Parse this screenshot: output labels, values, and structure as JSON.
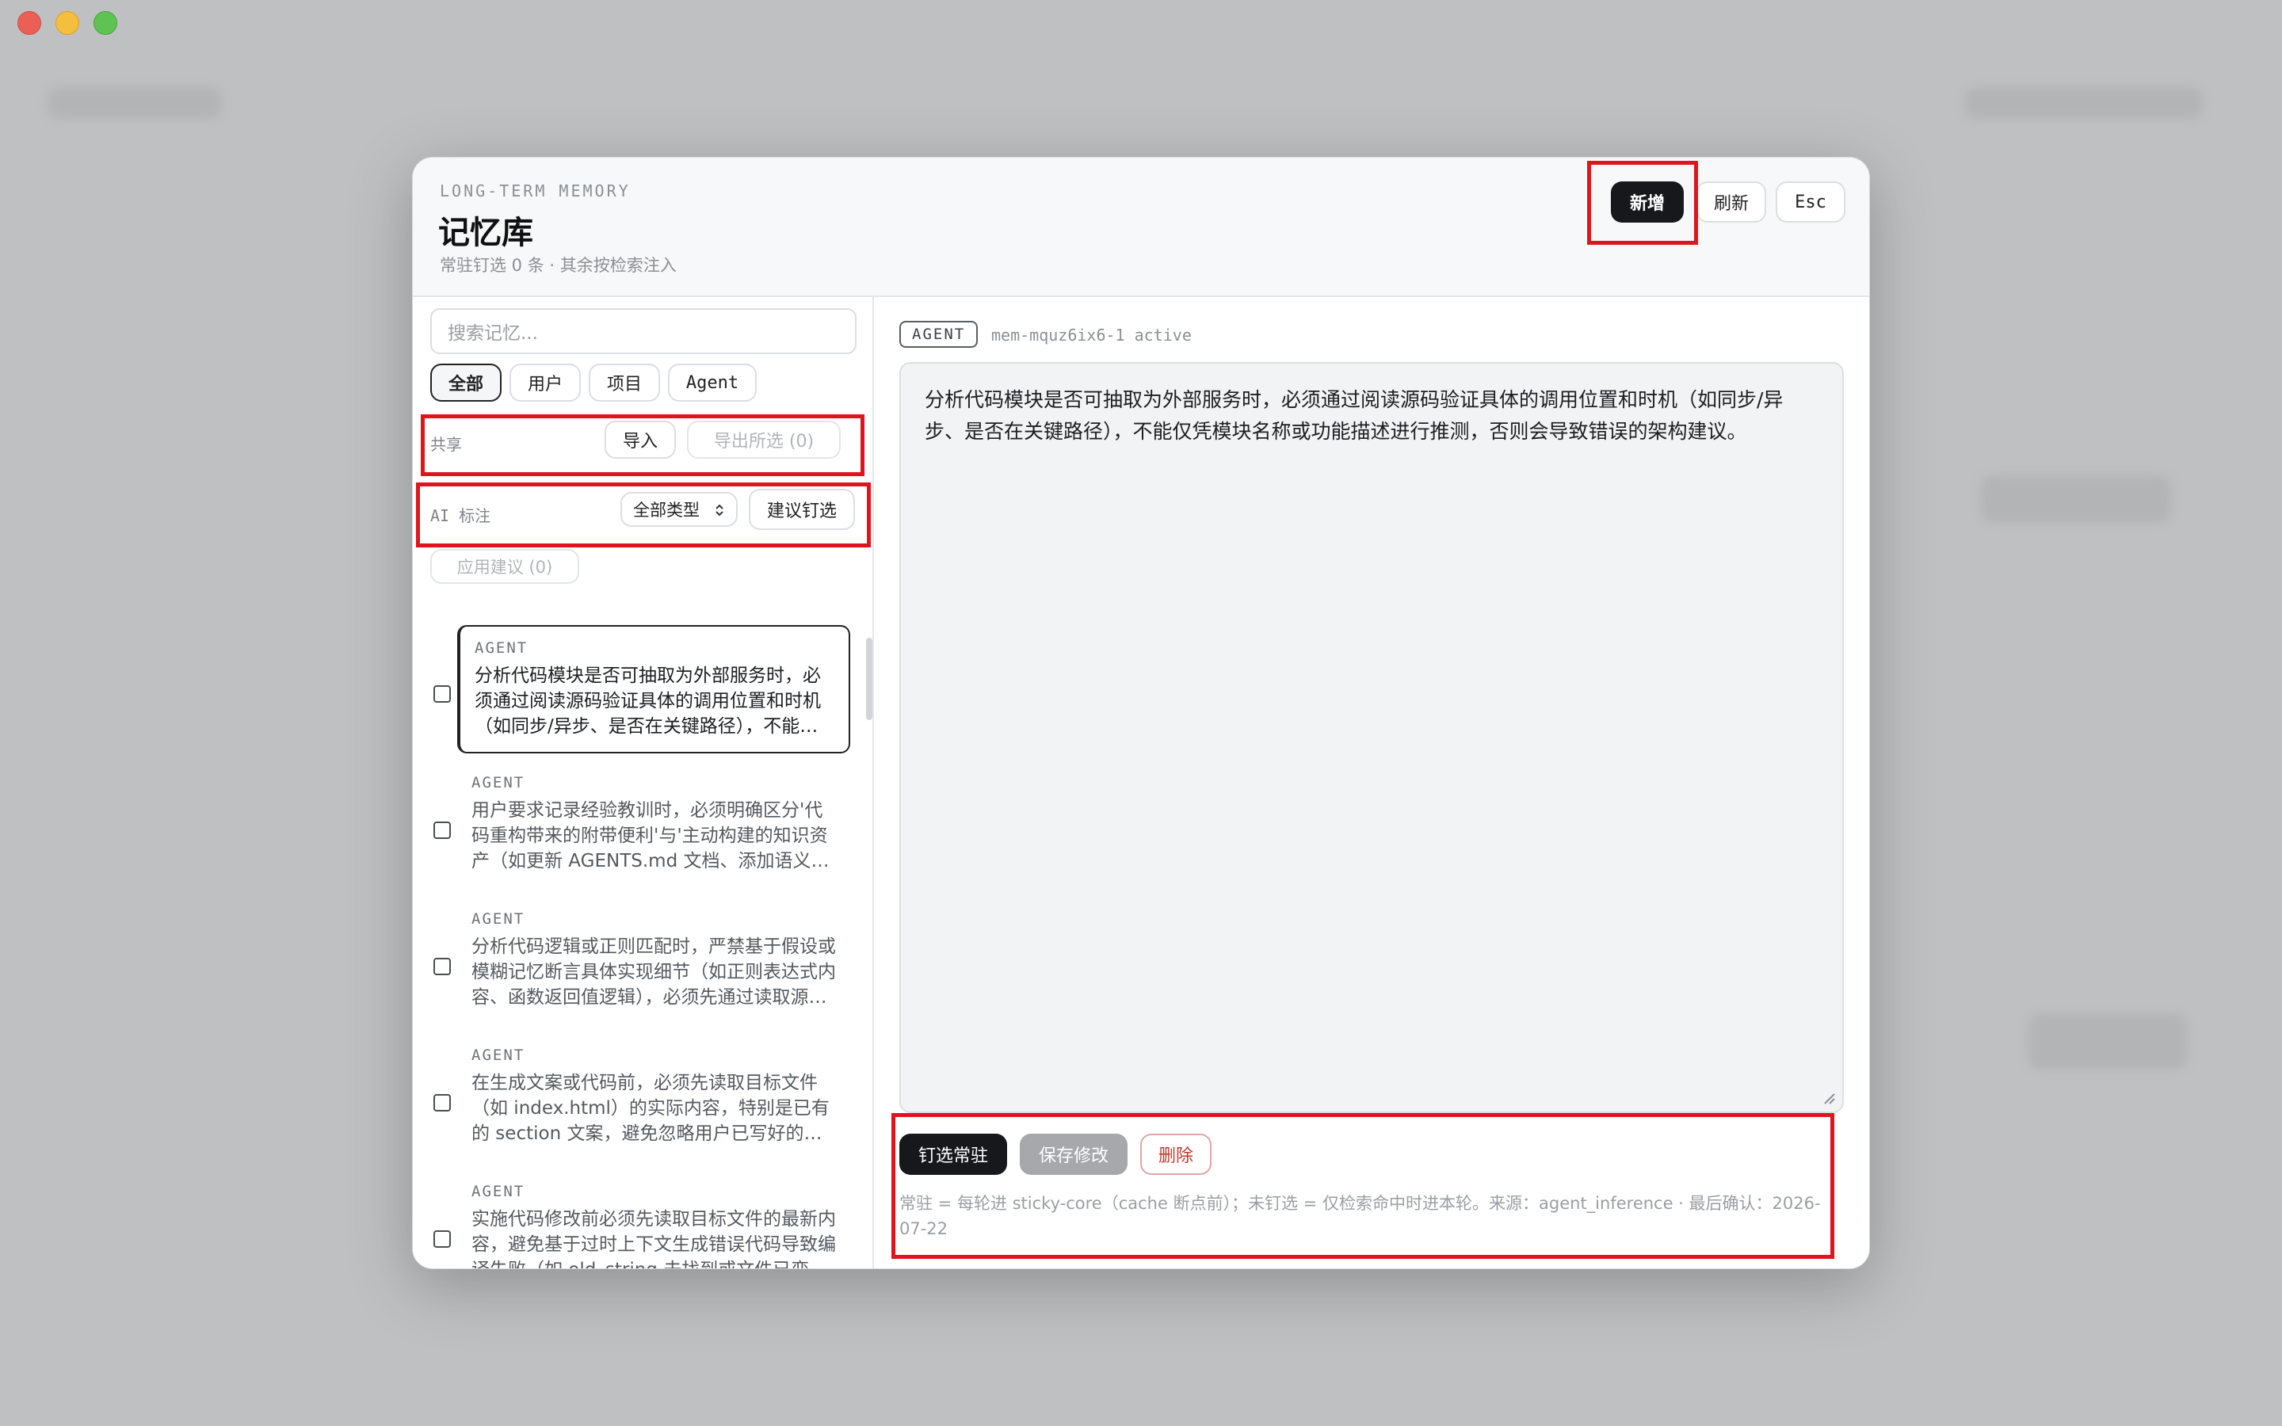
{
  "header": {
    "eyebrow": "LONG-TERM MEMORY",
    "title": "记忆库",
    "subtitle": "常驻钉选 0 条 · 其余按检索注入",
    "new_label": "新增",
    "refresh_label": "刷新",
    "esc_label": "Esc"
  },
  "search": {
    "placeholder": "搜索记忆..."
  },
  "filters": [
    "全部",
    "用户",
    "项目",
    "Agent"
  ],
  "share": {
    "label": "共享",
    "import_label": "导入",
    "export_label": "导出所选 (0)"
  },
  "ai": {
    "label": "AI 标注",
    "type_select": "全部类型",
    "suggest_label": "建议钉选",
    "apply_label": "应用建议 (0)"
  },
  "memories": [
    {
      "tag": "AGENT",
      "text": "分析代码模块是否可抽取为外部服务时，必须通过阅读源码验证具体的调用位置和时机（如同步/异步、是否在关键路径），不能仅凭模块名称或功能描述进行推测，否则会导致错误的架构建议。"
    },
    {
      "tag": "AGENT",
      "text": "用户要求记录经验教训时，必须明确区分'代码重构带来的附带便利'与'主动构建的知识资产（如更新 AGENTS.md 文档、添加语义注释等）'。"
    },
    {
      "tag": "AGENT",
      "text": "分析代码逻辑或正则匹配时，严禁基于假设或模糊记忆断言具体实现细节（如正则表达式内容、函数返回值逻辑），必须先通过读取源码确认。"
    },
    {
      "tag": "AGENT",
      "text": "在生成文案或代码前，必须先读取目标文件（如 index.html）的实际内容，特别是已有的 section 文案，避免忽略用户已写好的内容。"
    },
    {
      "tag": "AGENT",
      "text": "实施代码修改前必须先读取目标文件的最新内容，避免基于过时上下文生成错误代码导致编译失败（如 old_string 未找到或文件已变更）。"
    }
  ],
  "detail": {
    "tag": "AGENT",
    "meta": "mem-mquz6ix6-1 active",
    "content": "分析代码模块是否可抽取为外部服务时，必须通过阅读源码验证具体的调用位置和时机（如同步/异步、是否在关键路径），不能仅凭模块名称或功能描述进行推测，否则会导致错误的架构建议。",
    "pin_label": "钉选常驻",
    "save_label": "保存修改",
    "delete_label": "删除",
    "note": "常驻 = 每轮进 sticky-core（cache 断点前）；未钉选 = 仅检索命中时进本轮。来源：agent_inference · 最后确认：2026-07-22"
  },
  "colors": {
    "accent_dark": "#16181c",
    "highlight": "#e0141e",
    "danger": "#c0392b"
  }
}
